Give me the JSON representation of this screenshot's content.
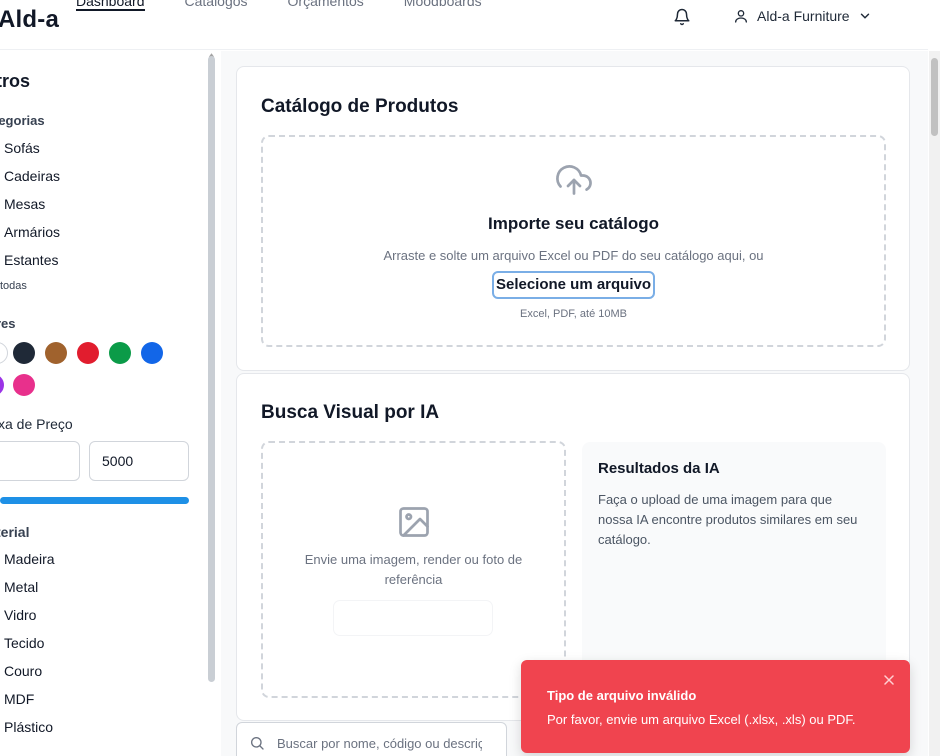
{
  "header": {
    "logo": "Ald-a",
    "nav": [
      "Dashboard",
      "Catálogos",
      "Orçamentos",
      "Moodboards"
    ],
    "user_name": "Ald-a Furniture"
  },
  "sidebar": {
    "title": "tros",
    "categories_label": "tegorias",
    "categories": [
      "Sofás",
      "Cadeiras",
      "Mesas",
      "Armários",
      "Estantes"
    ],
    "see_all": "todas",
    "colors_label": "res",
    "colors": [
      "#ffffff",
      "#1f2937",
      "#a0622d",
      "#e11d2e",
      "#0b9b48",
      "#1266e8",
      "#9b33e6",
      "#e8308c"
    ],
    "price_label": "xa de Preço",
    "price_min": "",
    "price_max": "5000",
    "material_label": "terial",
    "materials": [
      "Madeira",
      "Metal",
      "Vidro",
      "Tecido",
      "Couro",
      "MDF",
      "Plástico"
    ]
  },
  "catalog": {
    "title": "Catálogo de Produtos",
    "dropzone_title": "Importe seu catálogo",
    "dropzone_text": "Arraste e solte um arquivo Excel ou PDF do seu catálogo aqui, ou",
    "select_button": "Selecione um arquivo",
    "hint": "Excel, PDF, até 10MB"
  },
  "visual_search": {
    "title": "Busca Visual por IA",
    "dropzone_text_1": "Envie uma imagem, render ou foto de",
    "dropzone_text_2": "referência",
    "results_title": "Resultados da IA",
    "results_text": "Faça o upload de uma imagem para que nossa IA encontre produtos similares em seu catálogo."
  },
  "search": {
    "placeholder": "Buscar por nome, código ou descrição"
  },
  "toast": {
    "title": "Tipo de arquivo inválido",
    "message": "Por favor, envie um arquivo Excel (.xlsx, .xls) ou PDF."
  }
}
